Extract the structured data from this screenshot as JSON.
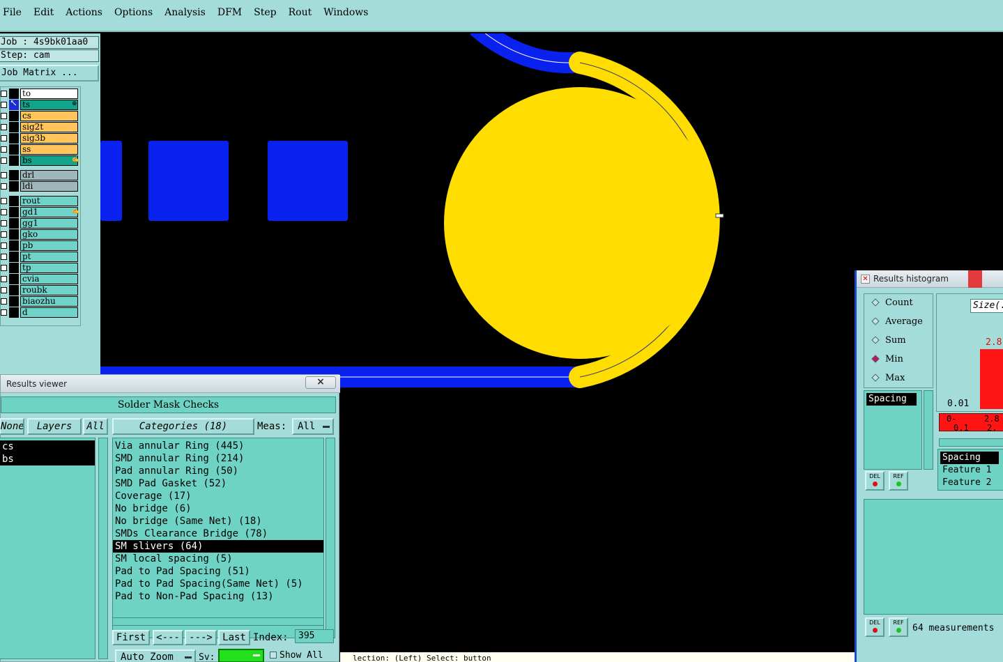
{
  "menu": {
    "items": [
      "File",
      "Edit",
      "Actions",
      "Options",
      "Analysis",
      "DFM",
      "Step",
      "Rout",
      "Windows"
    ]
  },
  "job": {
    "job_line": "Job : 4s9bk01aa0",
    "step_line": "Step: cam",
    "matrix_button": "Job Matrix ..."
  },
  "layers": [
    {
      "name": "to",
      "color": "#ffffff"
    },
    {
      "name": "ts",
      "color": "#13a58c",
      "mark": "⊕"
    },
    {
      "name": "cs",
      "color": "#ffc55a"
    },
    {
      "name": "sig2t",
      "color": "#ffc55a"
    },
    {
      "name": "sig3b",
      "color": "#ffc55a"
    },
    {
      "name": "ss",
      "color": "#ffc55a"
    },
    {
      "name": "bs",
      "color": "#13a58c",
      "mark": "✍"
    },
    {
      "name": "drl",
      "color": "#9fb7bb"
    },
    {
      "name": "ldi",
      "color": "#9fb7bb"
    },
    {
      "name": "rout",
      "color": "#6fd3ca"
    },
    {
      "name": "gd1",
      "color": "#6fd3ca",
      "mark": "✍"
    },
    {
      "name": "gg1",
      "color": "#6fd3ca"
    },
    {
      "name": "gko",
      "color": "#6fd3ca"
    },
    {
      "name": "pb",
      "color": "#6fd3ca"
    },
    {
      "name": "pt",
      "color": "#6fd3ca"
    },
    {
      "name": "tp",
      "color": "#6fd3ca"
    },
    {
      "name": "cvia",
      "color": "#6fd3ca"
    },
    {
      "name": "roubk",
      "color": "#6fd3ca"
    },
    {
      "name": "biaozhu",
      "color": "#6fd3ca"
    },
    {
      "name": "d",
      "color": "#6fd3ca"
    }
  ],
  "canvas": {
    "trace_color": "#0a22f0",
    "pad_color": "#ffdd00"
  },
  "results_viewer": {
    "title": "Results viewer",
    "close": "×",
    "heading": "Solder Mask Checks",
    "btn_none": "None",
    "btn_layers": "Layers",
    "btn_all": "All",
    "layer_items": [
      "cs",
      "bs"
    ],
    "categories_button": "Categories (18)",
    "meas_label": "Meas:",
    "meas_value": "All",
    "categories": [
      "Via annular Ring (445)",
      "SMD annular Ring (214)",
      "Pad annular Ring (50)",
      "SMD Pad Gasket (52)",
      "Coverage (17)",
      "No bridge (6)",
      "No bridge (Same Net) (18)",
      "SMDs Clearance Bridge (78)",
      "SM slivers (64)",
      "SM local spacing (5)",
      "Pad to Pad Spacing (51)",
      "Pad to Pad Spacing(Same Net) (5)",
      "Pad to Non-Pad Spacing (13)"
    ],
    "selected_category": 8,
    "nav": {
      "first": "First",
      "prev": "<---",
      "next": "--->",
      "last": "Last",
      "index_label": "Index:",
      "index_value": "395"
    },
    "auto_zoom": "Auto Zoom",
    "sv_label": "Sv:",
    "show_all": "Show All"
  },
  "histogram": {
    "title": "Results histogram",
    "modes": [
      "Count",
      "Average",
      "Sum",
      "Min",
      "Max"
    ],
    "selected_mode": "Min",
    "size_button": "Size(.",
    "bar_label": "2.8",
    "axis_label": "0.01",
    "range_row": [
      "0-",
      "2.8",
      "0.1",
      "2."
    ],
    "list_left": [
      "Spacing"
    ],
    "list_right": [
      "Spacing",
      "Feature 1",
      "Feature 2"
    ],
    "del": "DEL",
    "ref": "REF",
    "measurements": "64 measurements"
  },
  "status_text": "lection: (Left) Select: button"
}
